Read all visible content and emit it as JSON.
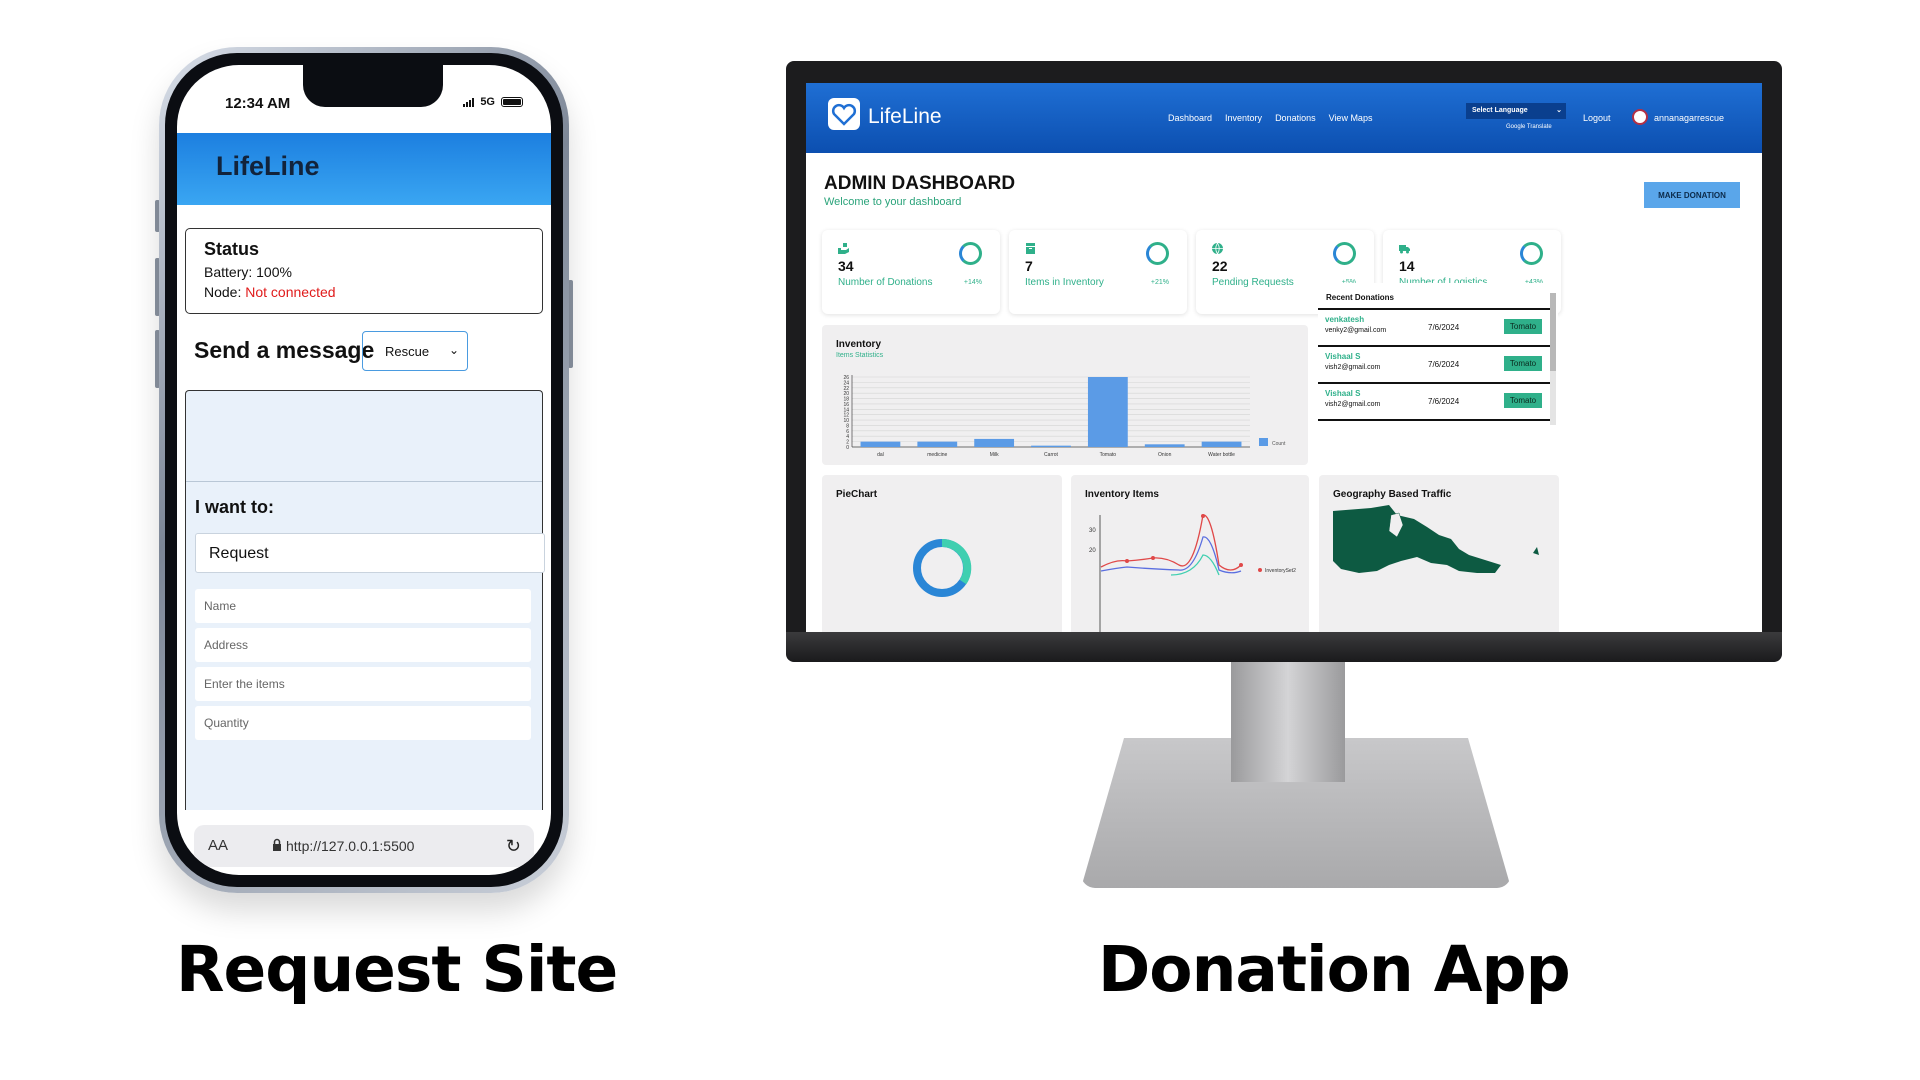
{
  "phone": {
    "time": "12:34 AM",
    "network": "5G",
    "app_title": "LifeLine",
    "status": {
      "title": "Status",
      "battery_label": "Battery: 100%",
      "node_label": "Node: ",
      "node_value": "Not connected"
    },
    "send_title": "Send a message",
    "message_type": "Rescue",
    "want_label": "I want to:",
    "want_value": "Request",
    "fields": {
      "name": "Name",
      "address": "Address",
      "items": "Enter the items",
      "quantity": "Quantity"
    },
    "url_bar": {
      "aa": "AA",
      "url": "http://127.0.0.1:5500"
    }
  },
  "captions": {
    "left": "Request Site",
    "right": "Donation App"
  },
  "dashboard": {
    "logo": "LifeLine",
    "nav": [
      "Dashboard",
      "Inventory",
      "Donations",
      "View Maps"
    ],
    "language_select": "Select Language",
    "google_translate": "Google Translate",
    "logout": "Logout",
    "user": "annanagarrescue",
    "title": "ADMIN DASHBOARD",
    "subtitle": "Welcome to your dashboard",
    "make_donation": "MAKE DONATION",
    "stats": [
      {
        "value": "34",
        "label": "Number of Donations",
        "pct": "+14%"
      },
      {
        "value": "7",
        "label": "Items in Inventory",
        "pct": "+21%"
      },
      {
        "value": "22",
        "label": "Pending Requests",
        "pct": "+5%"
      },
      {
        "value": "14",
        "label": "Number of Logistics",
        "pct": "+43%"
      }
    ],
    "inventory_panel": {
      "title": "Inventory",
      "subtitle": "Items Statistics",
      "legend": "Count"
    },
    "recent_title": "Recent Donations",
    "recent": [
      {
        "name": "venkatesh",
        "email": "venky2@gmail.com",
        "date": "7/6/2024",
        "item": "Tomato"
      },
      {
        "name": "Vishaal S",
        "email": "vish2@gmail.com",
        "date": "7/6/2024",
        "item": "Tomato"
      },
      {
        "name": "Vishaal S",
        "email": "vish2@gmail.com",
        "date": "7/6/2024",
        "item": "Tomato"
      }
    ],
    "piechart_title": "PieChart",
    "inventory_items_title": "Inventory Items",
    "inventory_items_legend": "InventorySet2",
    "inventory_items_ticks": [
      "30",
      "20"
    ],
    "geo_title": "Geography Based Traffic",
    "colors": {
      "accent_green": "#2fb08a",
      "bar_blue": "#5b9be6",
      "nav_blue": "#1f6fd4"
    }
  },
  "chart_data": {
    "type": "bar",
    "title": "Inventory",
    "subtitle": "Items Statistics",
    "categories": [
      "dal",
      "medicine",
      "Milk",
      "Carrot",
      "Tomato",
      "Onion",
      "Water bottle"
    ],
    "series": [
      {
        "name": "Count",
        "values": [
          2,
          2,
          3,
          0.5,
          26,
          1,
          2
        ]
      }
    ],
    "y_ticks": [
      "0",
      "2",
      "4",
      "6",
      "8",
      "10",
      "12",
      "14",
      "16",
      "18",
      "20",
      "22",
      "24",
      "26"
    ],
    "ylim": [
      0,
      26
    ],
    "grid": true,
    "legend": "right"
  }
}
